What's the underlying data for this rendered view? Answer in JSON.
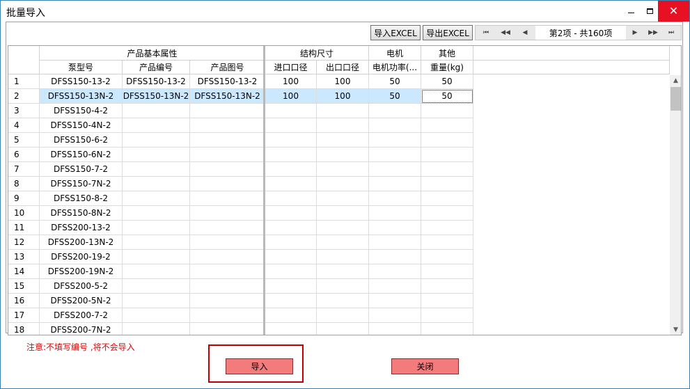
{
  "window": {
    "title": "批量导入"
  },
  "toolbar": {
    "import_excel": "导入EXCEL",
    "export_excel": "导出EXCEL"
  },
  "pager": {
    "text": "第2项 - 共160项",
    "first_icon": "first-page-icon",
    "prev_page_icon": "prev-page-icon",
    "prev_icon": "prev-icon",
    "next_icon": "next-icon",
    "next_page_icon": "next-page-icon",
    "last_icon": "last-page-icon"
  },
  "grid": {
    "groups": [
      "产品基本属性",
      "结构尺寸",
      "电机",
      "其他"
    ],
    "columns": [
      "泵型号",
      "产品编号",
      "产品图号",
      "进口口径",
      "出口口径",
      "电机功率(...",
      "重量(kg)"
    ],
    "selected_row": 2,
    "rows": [
      {
        "n": "1",
        "cells": [
          "DFSS150-13-2",
          "DFSS150-13-2",
          "DFSS150-13-2",
          "100",
          "100",
          "50",
          "50"
        ]
      },
      {
        "n": "2",
        "cells": [
          "DFSS150-13N-2",
          "DFSS150-13N-2",
          "DFSS150-13N-2",
          "100",
          "100",
          "50",
          "50"
        ]
      },
      {
        "n": "3",
        "cells": [
          "DFSS150-4-2",
          "",
          "",
          "",
          "",
          "",
          ""
        ]
      },
      {
        "n": "4",
        "cells": [
          "DFSS150-4N-2",
          "",
          "",
          "",
          "",
          "",
          ""
        ]
      },
      {
        "n": "5",
        "cells": [
          "DFSS150-6-2",
          "",
          "",
          "",
          "",
          "",
          ""
        ]
      },
      {
        "n": "6",
        "cells": [
          "DFSS150-6N-2",
          "",
          "",
          "",
          "",
          "",
          ""
        ]
      },
      {
        "n": "7",
        "cells": [
          "DFSS150-7-2",
          "",
          "",
          "",
          "",
          "",
          ""
        ]
      },
      {
        "n": "8",
        "cells": [
          "DFSS150-7N-2",
          "",
          "",
          "",
          "",
          "",
          ""
        ]
      },
      {
        "n": "9",
        "cells": [
          "DFSS150-8-2",
          "",
          "",
          "",
          "",
          "",
          ""
        ]
      },
      {
        "n": "10",
        "cells": [
          "DFSS150-8N-2",
          "",
          "",
          "",
          "",
          "",
          ""
        ]
      },
      {
        "n": "11",
        "cells": [
          "DFSS200-13-2",
          "",
          "",
          "",
          "",
          "",
          ""
        ]
      },
      {
        "n": "12",
        "cells": [
          "DFSS200-13N-2",
          "",
          "",
          "",
          "",
          "",
          ""
        ]
      },
      {
        "n": "13",
        "cells": [
          "DFSS200-19-2",
          "",
          "",
          "",
          "",
          "",
          ""
        ]
      },
      {
        "n": "14",
        "cells": [
          "DFSS200-19N-2",
          "",
          "",
          "",
          "",
          "",
          ""
        ]
      },
      {
        "n": "15",
        "cells": [
          "DFSS200-5-2",
          "",
          "",
          "",
          "",
          "",
          ""
        ]
      },
      {
        "n": "16",
        "cells": [
          "DFSS200-5N-2",
          "",
          "",
          "",
          "",
          "",
          ""
        ]
      },
      {
        "n": "17",
        "cells": [
          "DFSS200-7-2",
          "",
          "",
          "",
          "",
          "",
          ""
        ]
      },
      {
        "n": "18",
        "cells": [
          "DFSS200-7N-2",
          "",
          "",
          "",
          "",
          "",
          ""
        ]
      }
    ]
  },
  "note": "注意:不填写编号 ,将不会导入",
  "actions": {
    "import": "导入",
    "close": "关闭"
  },
  "colors": {
    "selected_row": "#cce8ff",
    "action_button": "#f47b7b",
    "note": "#e00000",
    "close_hover": "#e81123"
  }
}
